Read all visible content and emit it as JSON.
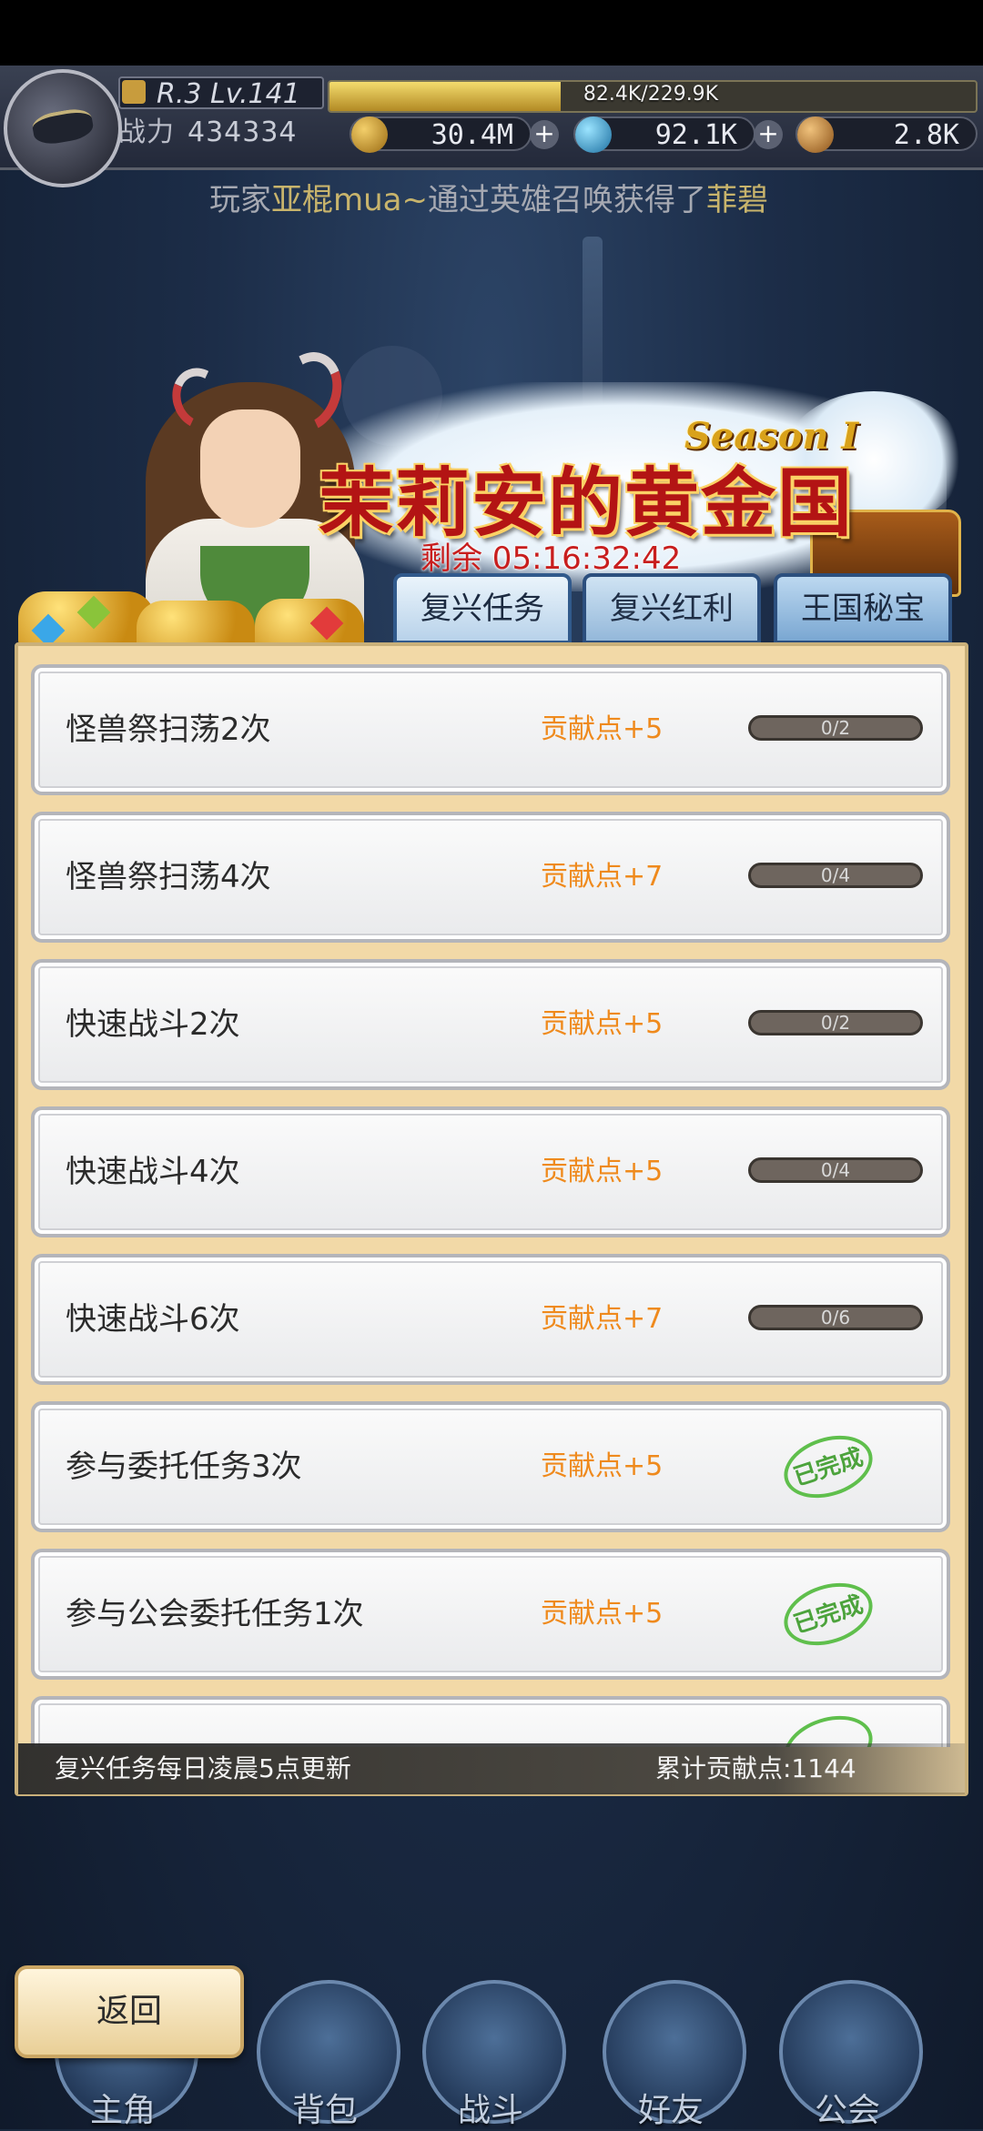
{
  "player": {
    "rank_level": "R.3 Lv.141",
    "exp_text": "82.4K/229.9K",
    "exp_progress": 0.358,
    "power_label": "战力",
    "power_value": "434334"
  },
  "resources": [
    {
      "icon": "coin-icon",
      "value": "30.4M"
    },
    {
      "icon": "diamond-icon",
      "value": "92.1K"
    },
    {
      "icon": "scroll-icon",
      "value": "2.8K"
    }
  ],
  "notice": {
    "prefix": "玩家",
    "player": "亚棍mua~",
    "middle": "通过英雄召唤获得了",
    "hero": "菲碧"
  },
  "banner": {
    "season": "Season Ⅰ",
    "title": "茉莉安的黄金国",
    "countdown": "剩余 05:16:32:42"
  },
  "tabs": [
    {
      "label": "复兴任务"
    },
    {
      "label": "复兴红利"
    },
    {
      "label": "王国秘宝"
    }
  ],
  "tasks": [
    {
      "name": "怪兽祭扫荡2次",
      "reward": "贡献点+5",
      "progress": "0/2",
      "done": false
    },
    {
      "name": "怪兽祭扫荡4次",
      "reward": "贡献点+7",
      "progress": "0/4",
      "done": false
    },
    {
      "name": "快速战斗2次",
      "reward": "贡献点+5",
      "progress": "0/2",
      "done": false
    },
    {
      "name": "快速战斗4次",
      "reward": "贡献点+5",
      "progress": "0/4",
      "done": false
    },
    {
      "name": "快速战斗6次",
      "reward": "贡献点+7",
      "progress": "0/6",
      "done": false
    },
    {
      "name": "参与委托任务3次",
      "reward": "贡献点+5",
      "status": "已完成",
      "done": true
    },
    {
      "name": "参与公会委托任务1次",
      "reward": "贡献点+5",
      "status": "已完成",
      "done": true
    }
  ],
  "footer": {
    "refresh_note": "复兴任务每日凌晨5点更新",
    "total_label": "累计贡献点:1144"
  },
  "back_button": "返回",
  "nav": [
    {
      "label": "主角"
    },
    {
      "label": "背包"
    },
    {
      "label": "战斗"
    },
    {
      "label": "好友"
    },
    {
      "label": "公会"
    }
  ],
  "colors": {
    "reward_orange": "#ef8a1d",
    "done_green": "#4ca33c",
    "title_red": "#b31414",
    "panel_bg": "#f2d9a7"
  }
}
